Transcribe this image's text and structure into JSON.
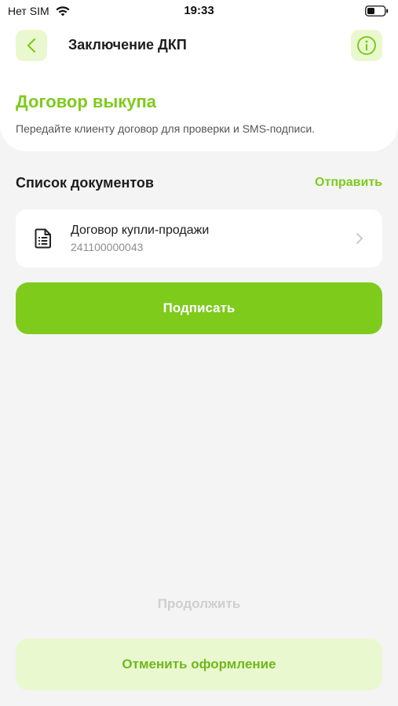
{
  "status_bar": {
    "carrier": "Нет SIM",
    "time": "19:33"
  },
  "header": {
    "title": "Заключение ДКП",
    "back_icon": "chevron-left-icon",
    "info_icon": "info-icon"
  },
  "hero": {
    "title": "Договор выкупа",
    "subtitle": "Передайте клиенту договор для проверки и SMS-подписи."
  },
  "documents": {
    "section_title": "Список документов",
    "send_label": "Отправить",
    "items": [
      {
        "title": "Договор купли-продажи",
        "number": "241100000043",
        "icon": "document-icon"
      }
    ]
  },
  "actions": {
    "sign_label": "Подписать",
    "continue_label": "Продолжить",
    "cancel_label": "Отменить оформление"
  },
  "colors": {
    "accent": "#7ecb1c",
    "accent_light": "#eaf8cf",
    "background": "#f4f4f4",
    "card": "#ffffff",
    "disabled_text": "#cfcfcf"
  }
}
